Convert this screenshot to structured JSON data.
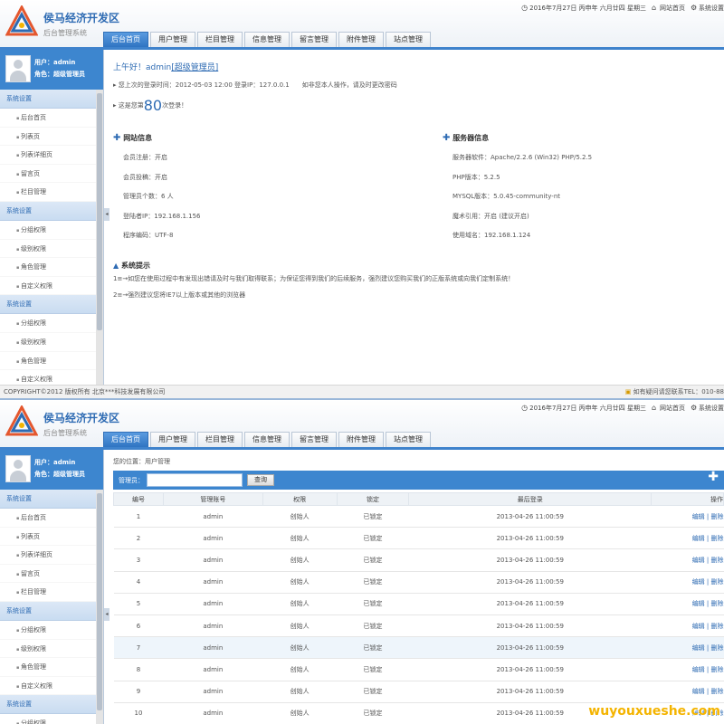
{
  "app": {
    "title": "侯马经济开发区",
    "subtitle": "后台管理系统"
  },
  "toplinks": {
    "date": "2016年7月27日 丙申年 六月廿四 星期三",
    "home": "网站首页",
    "settings": "系统设置"
  },
  "nav": [
    "后台首页",
    "用户管理",
    "栏目管理",
    "信息管理",
    "留言管理",
    "附件管理",
    "站点管理"
  ],
  "user": {
    "name": "用户：admin",
    "role": "角色：超级管理员"
  },
  "sidebar": {
    "sections": [
      {
        "title": "系统设置",
        "items": [
          "后台首页",
          "列表页",
          "列表详细页",
          "留言页",
          "栏目管理"
        ]
      },
      {
        "title": "系统设置",
        "items": [
          "分组权限",
          "级别权限",
          "角色管理",
          "自定义权限"
        ]
      },
      {
        "title": "系统设置",
        "items": [
          "分组权限",
          "级别权限",
          "角色管理",
          "自定义权限"
        ]
      }
    ]
  },
  "home": {
    "greeting": "上午好！admin",
    "greeting_link": "[超级管理员]",
    "last_login": "您上次的登录时间：2012-05-03 12:00 登录IP：127.0.0.1",
    "last_login_note": "如非您本人操作，请及时更改密码",
    "login_count_pre": "这是您第",
    "login_count": "80",
    "login_count_post": "次登录！",
    "site_info_title": "网站信息",
    "site_info": [
      "会员注册：开启",
      "会员投稿：开启",
      "管理员个数：6 人",
      "登陆者IP：192.168.1.156",
      "程序编码：UTF-8"
    ],
    "server_info_title": "服务器信息",
    "server_info": [
      "服务器软件：Apache/2.2.6 (Win32) PHP/5.2.5",
      "PHP版本：5.2.5",
      "MYSQL版本：5.0.45-community-nt",
      "魔术引用：开启 (建议开启)",
      "使用域名：192.168.1.124"
    ],
    "tips_title": "系统提示",
    "tips": [
      "1≡→如您在使用过程中有发现出错请及时与我们取得联系；为保证您得到我们的后续服务，强烈建议您购买我们的正版系统或向我们定制系统！",
      "2≡→强烈建议您将IE7以上版本或其他的浏览器"
    ]
  },
  "footer": {
    "copyright": "COPYRIGHT©2012 版权所有 北京***科技发展有限公司",
    "contact": "如有疑问请您联系TEL：010-88"
  },
  "users_page": {
    "crumb": "您的位置：用户管理",
    "search_label": "管理员：",
    "search_value": "",
    "search_button": "查询",
    "columns": [
      "编号",
      "管理账号",
      "权限",
      "锁定",
      "最后登录",
      "操作"
    ],
    "rows": [
      [
        "1",
        "admin",
        "创始人",
        "已锁定",
        "2013-04-26 11:00:59",
        "编辑 | 删除"
      ],
      [
        "2",
        "admin",
        "创始人",
        "已锁定",
        "2013-04-26 11:00:59",
        "编辑 | 删除"
      ],
      [
        "3",
        "admin",
        "创始人",
        "已锁定",
        "2013-04-26 11:00:59",
        "编辑 | 删除"
      ],
      [
        "4",
        "admin",
        "创始人",
        "已锁定",
        "2013-04-26 11:00:59",
        "编辑 | 删除"
      ],
      [
        "5",
        "admin",
        "创始人",
        "已锁定",
        "2013-04-26 11:00:59",
        "编辑 | 删除"
      ],
      [
        "6",
        "admin",
        "创始人",
        "已锁定",
        "2013-04-26 11:00:59",
        "编辑 | 删除"
      ],
      [
        "7",
        "admin",
        "创始人",
        "已锁定",
        "2013-04-26 11:00:59",
        "编辑 | 删除"
      ],
      [
        "8",
        "admin",
        "创始人",
        "已锁定",
        "2013-04-26 11:00:59",
        "编辑 | 删除"
      ],
      [
        "9",
        "admin",
        "创始人",
        "已锁定",
        "2013-04-26 11:00:59",
        "编辑 | 删除"
      ],
      [
        "10",
        "admin",
        "创始人",
        "已锁定",
        "2013-04-26 11:00:59",
        "编辑 | 删除"
      ]
    ],
    "highlight_row": 7
  },
  "watermark": "wuyouxueshe.com",
  "colors": {
    "accent": "#3d86cf",
    "brand": "#2e6bb3"
  }
}
